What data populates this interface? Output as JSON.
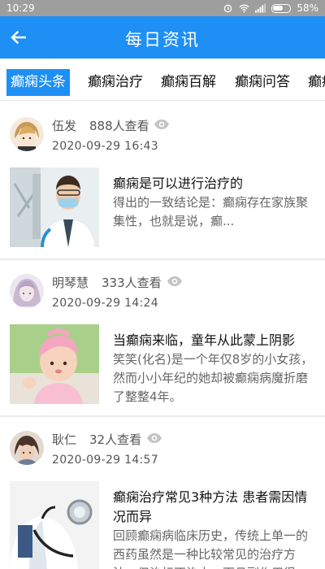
{
  "status_bar": {
    "time": "10:29",
    "battery": "58%"
  },
  "header": {
    "title": "每日资讯"
  },
  "tabs": [
    {
      "label": "癫痫头条",
      "active": true
    },
    {
      "label": "癫痫治疗",
      "active": false
    },
    {
      "label": "癫痫百解",
      "active": false
    },
    {
      "label": "癫痫问答",
      "active": false
    },
    {
      "label": "癫痫",
      "active": false
    }
  ],
  "articles": [
    {
      "author": "伍发",
      "views": "888人查看",
      "date": "2020-09-29 16:43",
      "title": "癫痫是可以进行治疗的",
      "excerpt": "得出的一致结论是：癫痫存在家族聚集性，也就是说，癫..."
    },
    {
      "author": "明琴慧",
      "views": "333人查看",
      "date": "2020-09-29 14:24",
      "title": "当癫痫来临，童年从此蒙上阴影",
      "excerpt": "笑笑(化名)是一个年仅8岁的小女孩，然而小小年纪的她却被癫痫病魔折磨了整整4年。"
    },
    {
      "author": "耿仁",
      "views": "32人查看",
      "date": "2020-09-29 14:57",
      "title": "癫痫治疗常见3种方法 患者需因情况而异",
      "excerpt": "回顾癫痫病临床历史，传统上单一的西药虽然是一种比较常见的治疗方法，但治标不治本，而且副作用很"
    }
  ],
  "colors": {
    "primary": "#1e8ff5",
    "status_bar": "#9e9e9e"
  }
}
